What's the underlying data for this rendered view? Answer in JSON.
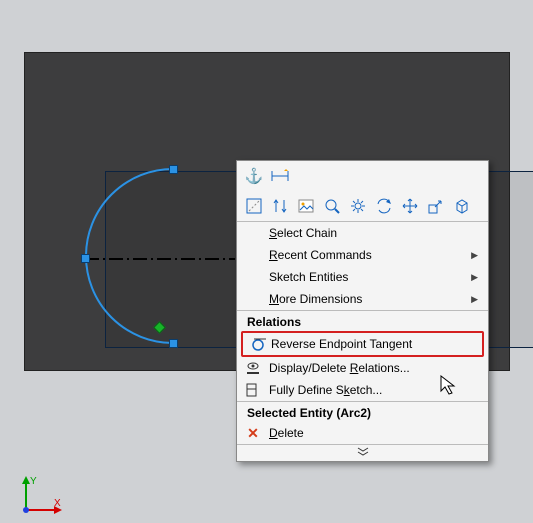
{
  "menu": {
    "select_chain": {
      "pre": "S",
      "rest": "elect Chain"
    },
    "recent_commands": {
      "pre": "R",
      "rest": "ecent Commands"
    },
    "sketch_entities": "Sketch Entities",
    "more_dimensions": {
      "pre": "M",
      "rest": "ore Dimensions"
    },
    "relations_header": "Relations",
    "reverse_endpoint": "Reverse Endpoint Tangent",
    "display_delete": {
      "pre": "Display/Delete ",
      "und": "R",
      "rest": "elations..."
    },
    "fully_define": {
      "pre": "Fully Define S",
      "und": "k",
      "rest": "etch..."
    },
    "selected_entity_header": "Selected Entity (Arc2)",
    "delete": {
      "pre": "D",
      "rest": "elete"
    }
  },
  "icons": {
    "anchor": "⚓",
    "delete_x": "✕",
    "chevrons": "»"
  },
  "axes": {
    "x": "X",
    "y": "Y"
  }
}
